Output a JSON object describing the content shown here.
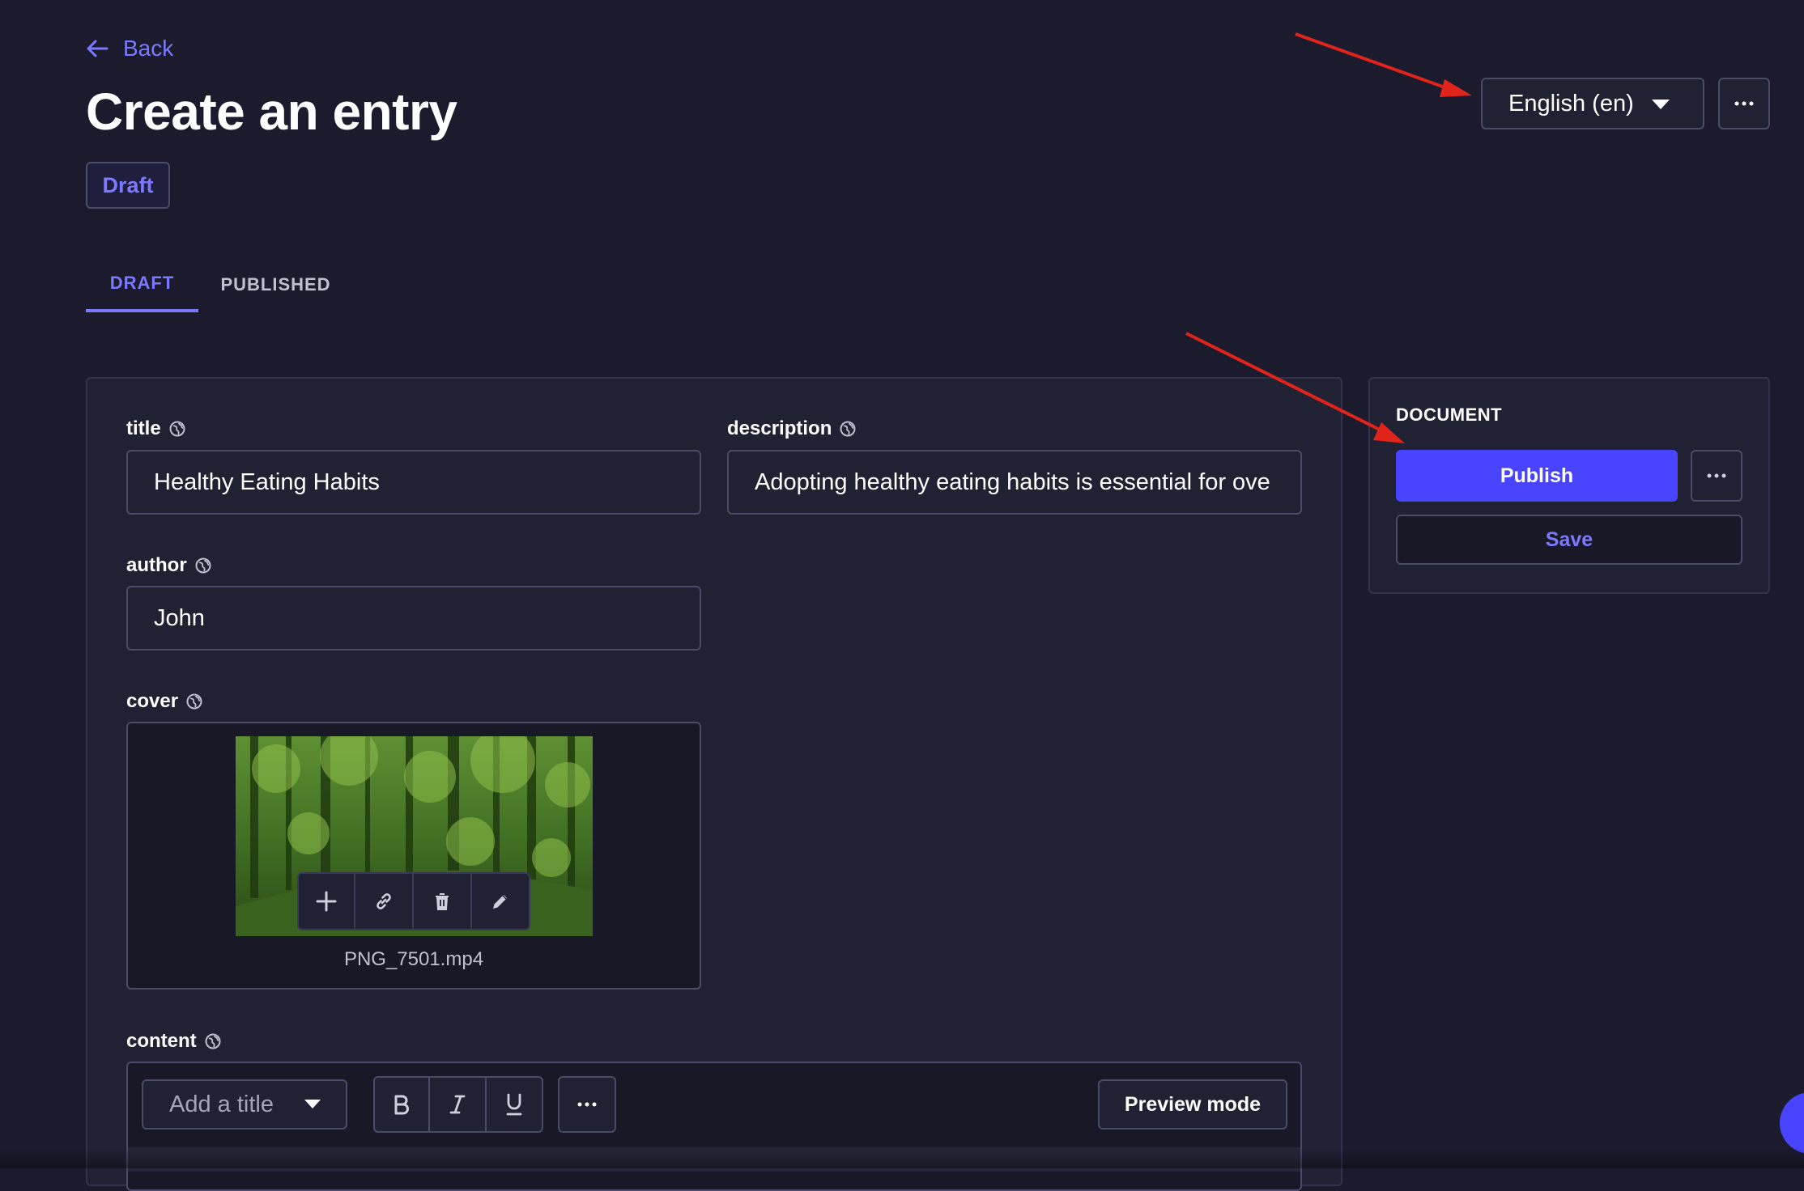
{
  "header": {
    "back_label": "Back",
    "title": "Create an entry",
    "status_badge": "Draft"
  },
  "tabs": [
    {
      "label": "DRAFT",
      "active": true
    },
    {
      "label": "PUBLISHED",
      "active": false
    }
  ],
  "locale": {
    "selected": "English (en)"
  },
  "fields": {
    "title": {
      "label": "title",
      "value": "Healthy Eating Habits"
    },
    "description": {
      "label": "description",
      "value": "Adopting healthy eating habits is essential for ove"
    },
    "author": {
      "label": "author",
      "value": "John"
    },
    "cover": {
      "label": "cover",
      "filename": "PNG_7501.mp4"
    },
    "content": {
      "label": "content"
    }
  },
  "editor": {
    "heading_placeholder": "Add a title",
    "preview_label": "Preview mode"
  },
  "document_panel": {
    "title": "DOCUMENT",
    "publish_label": "Publish",
    "save_label": "Save"
  },
  "colors": {
    "background": "#1b1b2d",
    "surface": "#212134",
    "primary": "#4945ff",
    "accent_text": "#7b79ff",
    "border": "#4a4a6a",
    "annotation_arrow": "#e0231b"
  },
  "icons": [
    "arrow-left-icon",
    "globe-icon",
    "chevron-down-icon",
    "more-icon",
    "plus-icon",
    "link-icon",
    "trash-icon",
    "pencil-icon",
    "bold-icon",
    "italic-icon",
    "underline-icon"
  ]
}
